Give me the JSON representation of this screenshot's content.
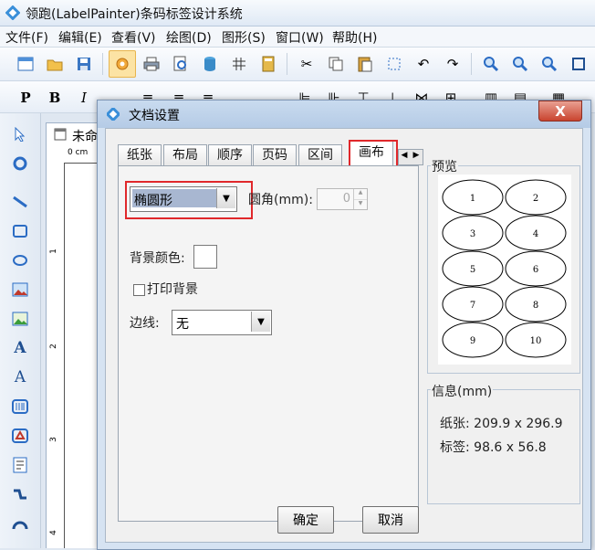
{
  "app": {
    "title": "领跑(LabelPainter)条码标签设计系统"
  },
  "menu": [
    {
      "label": "文件(F)"
    },
    {
      "label": "编辑(E)"
    },
    {
      "label": "查看(V)"
    },
    {
      "label": "绘图(D)"
    },
    {
      "label": "图形(S)"
    },
    {
      "label": "窗口(W)"
    },
    {
      "label": "帮助(H)"
    }
  ],
  "toolbar2": {
    "bold": "B",
    "italic": "I",
    "plain": "P"
  },
  "document": {
    "tab_label": "未命",
    "ruler_unit": "0 cm",
    "ruler_ticks": [
      "1",
      "2",
      "3",
      "4"
    ]
  },
  "dialog": {
    "title": "文档设置",
    "close": "X",
    "tabs": [
      "纸张",
      "布局",
      "顺序",
      "页码",
      "区间",
      "画布"
    ],
    "active_tab": "画布",
    "canvas": {
      "shape_value": "椭圆形",
      "corner_label": "圆角(mm):",
      "corner_value": "0",
      "bg_color_label": "背景颜色:",
      "print_bg_label": "打印背景",
      "print_bg_checked": false,
      "border_label": "边线:",
      "border_value": "无"
    },
    "preview": {
      "label": "预览",
      "labels": [
        "1",
        "2",
        "3",
        "4",
        "5",
        "6",
        "7",
        "8",
        "9",
        "10"
      ]
    },
    "info": {
      "label": "信息(mm)",
      "paper": "纸张: 209.9 x 296.9",
      "tag": "标签: 98.6 x 56.8"
    },
    "buttons": {
      "ok": "确定",
      "cancel": "取消"
    }
  },
  "colors": {
    "highlight": "#e0282b",
    "accent": "#2b6cc4"
  }
}
